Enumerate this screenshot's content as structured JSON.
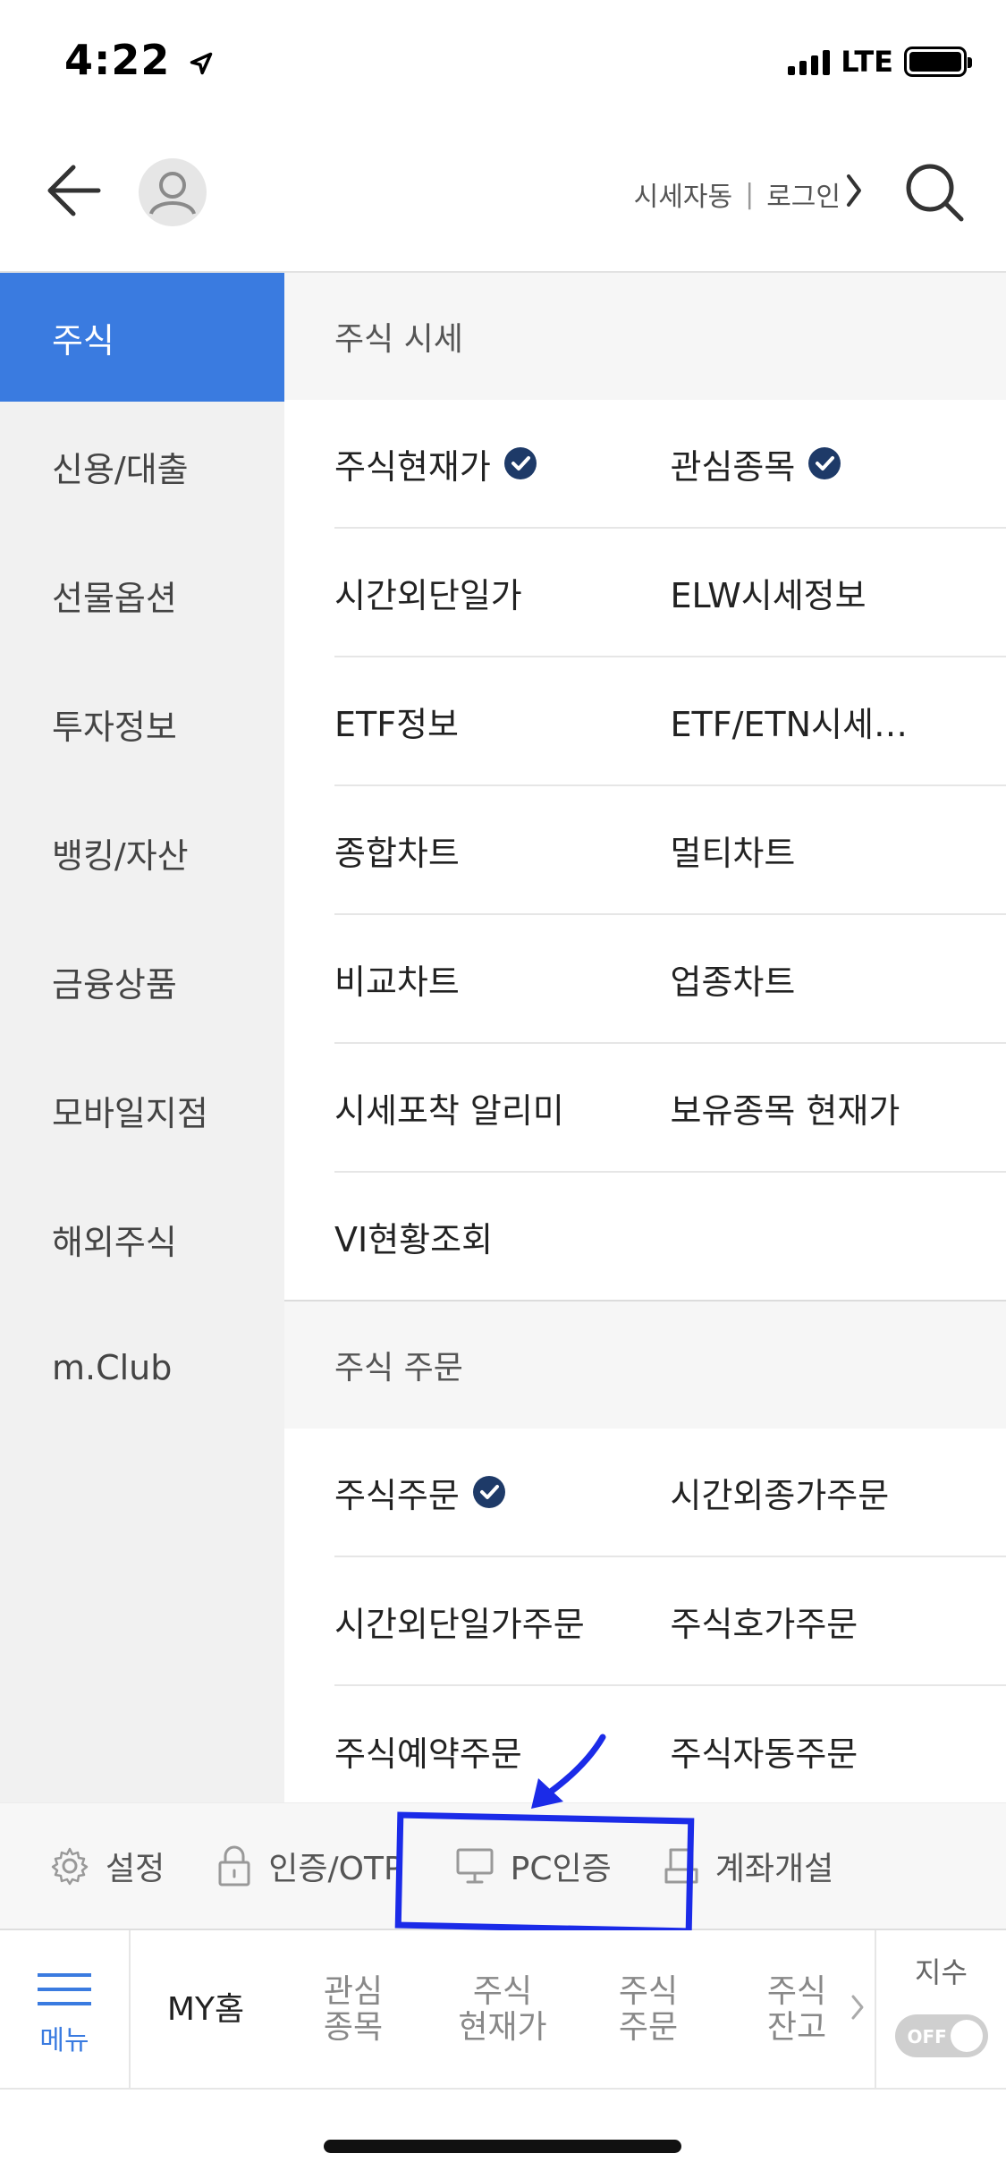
{
  "status_bar": {
    "time": "4:22",
    "network": "LTE"
  },
  "header": {
    "quote_auto_label": "시세자동",
    "separator": "|",
    "login_label": "로그인"
  },
  "left_nav": {
    "items": [
      {
        "label": "주식",
        "active": true
      },
      {
        "label": "신용/대출",
        "active": false
      },
      {
        "label": "선물옵션",
        "active": false
      },
      {
        "label": "투자정보",
        "active": false
      },
      {
        "label": "뱅킹/자산",
        "active": false
      },
      {
        "label": "금융상품",
        "active": false
      },
      {
        "label": "모바일지점",
        "active": false
      },
      {
        "label": "해외주식",
        "active": false
      },
      {
        "label": "m.Club",
        "active": false
      }
    ]
  },
  "sections": [
    {
      "title": "주식 시세",
      "rows": [
        [
          {
            "label": "주식현재가",
            "checked": true
          },
          {
            "label": "관심종목",
            "checked": true
          }
        ],
        [
          {
            "label": "시간외단일가",
            "checked": false
          },
          {
            "label": "ELW시세정보",
            "checked": false
          }
        ],
        [
          {
            "label": "ETF정보",
            "checked": false
          },
          {
            "label": "ETF/ETN시세…",
            "checked": false
          }
        ],
        [
          {
            "label": "종합차트",
            "checked": false
          },
          {
            "label": "멀티차트",
            "checked": false
          }
        ],
        [
          {
            "label": "비교차트",
            "checked": false
          },
          {
            "label": "업종차트",
            "checked": false
          }
        ],
        [
          {
            "label": "시세포착 알리미",
            "checked": false
          },
          {
            "label": "보유종목 현재가",
            "checked": false
          }
        ],
        [
          {
            "label": "VI현황조회",
            "checked": false
          }
        ]
      ]
    },
    {
      "title": "주식 주문",
      "rows": [
        [
          {
            "label": "주식주문",
            "checked": true
          },
          {
            "label": "시간외종가주문",
            "checked": false
          }
        ],
        [
          {
            "label": "시간외단일가주문",
            "checked": false
          },
          {
            "label": "주식호가주문",
            "checked": false
          }
        ],
        [
          {
            "label": "주식예약주문",
            "checked": false
          },
          {
            "label": "주식자동주문",
            "checked": false
          }
        ]
      ]
    }
  ],
  "quick_bar": {
    "settings": "설정",
    "auth_otp": "인증/OTP",
    "pc_auth": "PC인증",
    "open_account": "계좌개설"
  },
  "tab_bar": {
    "menu": "메뉴",
    "my_home": "MY홈",
    "watchlist": [
      "관심",
      "종목"
    ],
    "current_price": [
      "주식",
      "현재가"
    ],
    "stock_order": [
      "주식",
      "주문"
    ],
    "stock_balance": [
      "주식",
      "잔고"
    ],
    "index_label": "지수",
    "index_toggle": "OFF"
  },
  "colors": {
    "accent": "#3a7be0",
    "check_badge": "#1e3a68",
    "annotation": "#1b2be8"
  }
}
